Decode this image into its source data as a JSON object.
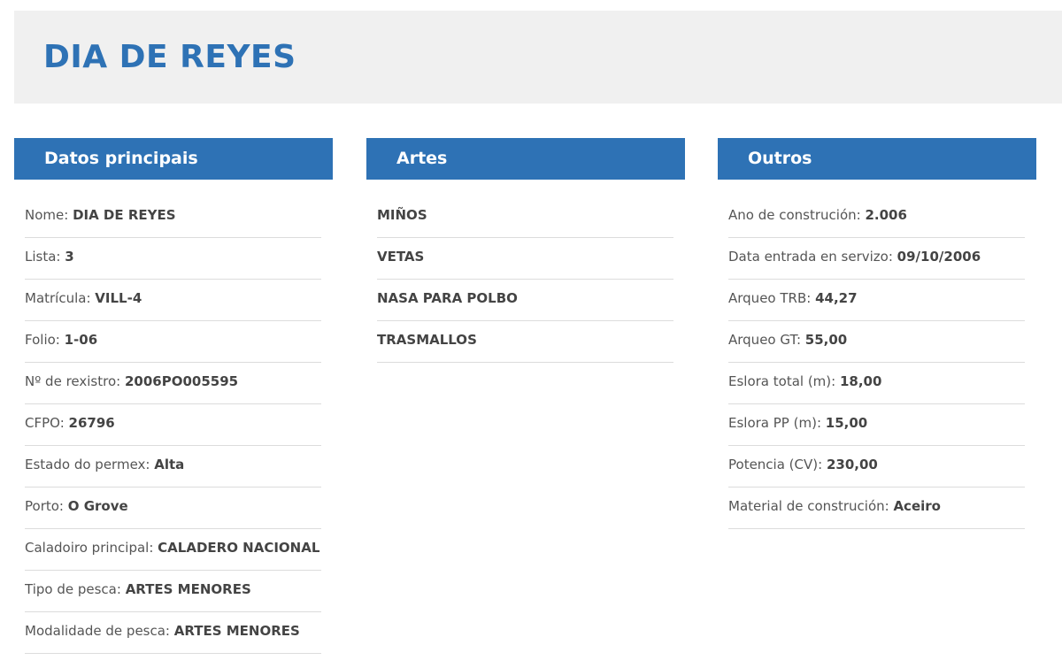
{
  "title": "DIA DE REYES",
  "panels": {
    "principais": {
      "header": "Datos principais",
      "rows": [
        {
          "label": "Nome: ",
          "value": "DIA DE REYES"
        },
        {
          "label": "Lista: ",
          "value": "3"
        },
        {
          "label": "Matrícula: ",
          "value": "VILL-4"
        },
        {
          "label": "Folio: ",
          "value": "1-06"
        },
        {
          "label": "Nº de rexistro: ",
          "value": "2006PO005595"
        },
        {
          "label": "CFPO: ",
          "value": "26796"
        },
        {
          "label": "Estado do permex: ",
          "value": "Alta"
        },
        {
          "label": "Porto: ",
          "value": "O Grove"
        },
        {
          "label": "Caladoiro principal: ",
          "value": "CALADERO NACIONAL"
        },
        {
          "label": "Tipo de pesca: ",
          "value": "ARTES MENORES"
        },
        {
          "label": "Modalidade de pesca: ",
          "value": "ARTES MENORES"
        }
      ]
    },
    "artes": {
      "header": "Artes",
      "rows": [
        {
          "label": "",
          "value": "MIÑOS"
        },
        {
          "label": "",
          "value": "VETAS"
        },
        {
          "label": "",
          "value": "NASA PARA POLBO"
        },
        {
          "label": "",
          "value": "TRASMALLOS"
        }
      ]
    },
    "outros": {
      "header": "Outros",
      "rows": [
        {
          "label": "Ano de construción: ",
          "value": "2.006"
        },
        {
          "label": "Data entrada en servizo: ",
          "value": "09/10/2006"
        },
        {
          "label": "Arqueo TRB: ",
          "value": "44,27"
        },
        {
          "label": "Arqueo GT: ",
          "value": "55,00"
        },
        {
          "label": "Eslora total (m): ",
          "value": "18,00"
        },
        {
          "label": "Eslora PP (m): ",
          "value": "15,00"
        },
        {
          "label": "Potencia (CV): ",
          "value": "230,00"
        },
        {
          "label": "Material de construción: ",
          "value": "Aceiro"
        }
      ]
    }
  }
}
